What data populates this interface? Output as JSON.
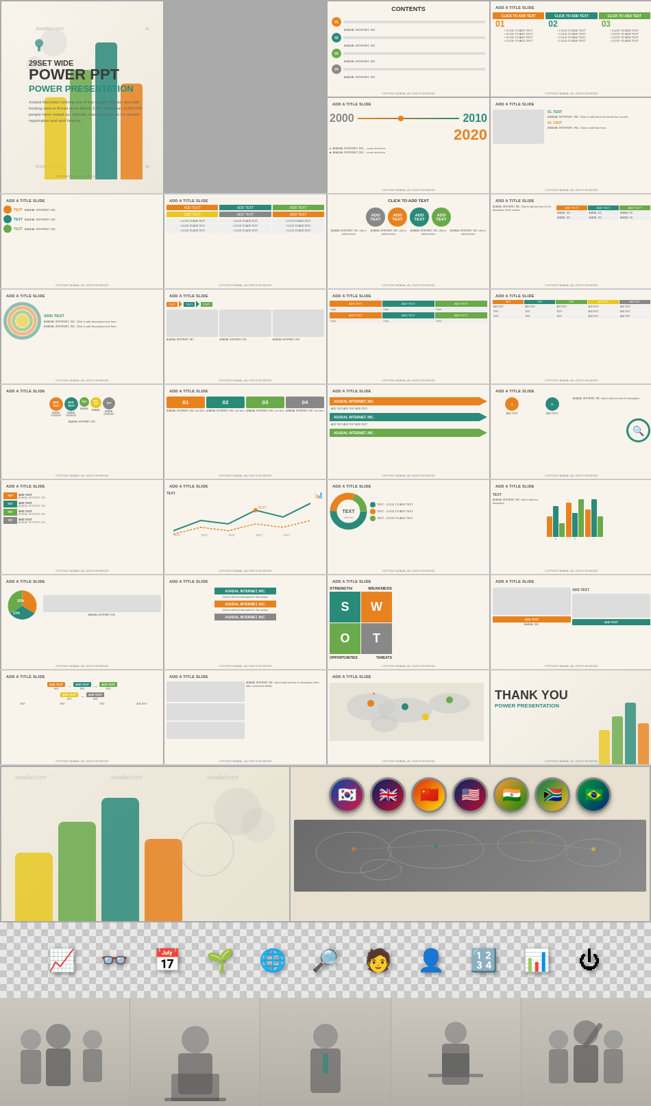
{
  "page": {
    "title": "29SET WIDE POWER PPT",
    "subtitle": "POWER PRESENTATION",
    "watermarks": [
      "asadal.com",
      "asadal.com"
    ],
    "copyright": "COPYRIGHT ASADAL, ALL RIGHTS RESERVED"
  },
  "hero": {
    "set_label": "29SET WIDE",
    "title_line1": "POWER PPT",
    "subtitle": "POWER PRESENTATION",
    "description": "Asadal has been running one of the biggest domain and web hosting sites in Korea since March 1998. More than 3,000,000 people have visited our website, www.asadal.com for domain registration and web hosting.",
    "website": "www.asadal.com"
  },
  "slides": {
    "slide_title_label": "ADD A TITLE SLIDE",
    "click_to_add": "CLICK TO ADD TEXT",
    "add_text": "ADD TEXT",
    "text_label": "TEXT",
    "asadal_internet": "ASADAL INTERNET, INC.",
    "contents": "CONTENTS"
  },
  "flags": [
    "🇰🇷",
    "🇬🇧",
    "🇨🇳",
    "🇺🇸",
    "🇮🇳",
    "🇿🇦",
    "🇧🇷"
  ],
  "business_icons": [
    "📈",
    "👓",
    "📅",
    "🌱",
    "🌐",
    "🔍",
    "👤",
    "👤",
    "🔢",
    "📊",
    "⏻"
  ],
  "people_groups": [
    "Team Group 1",
    "Speaker at Laptop",
    "Business Presenter",
    "Executive at Desk",
    "Celebrating Team"
  ],
  "colors": {
    "teal": "#2a8a7a",
    "orange": "#e8821e",
    "green": "#6aaa4a",
    "yellow": "#e8c820",
    "gray": "#888888",
    "light_bg": "#f8f4ec",
    "dark_text": "#333333"
  }
}
